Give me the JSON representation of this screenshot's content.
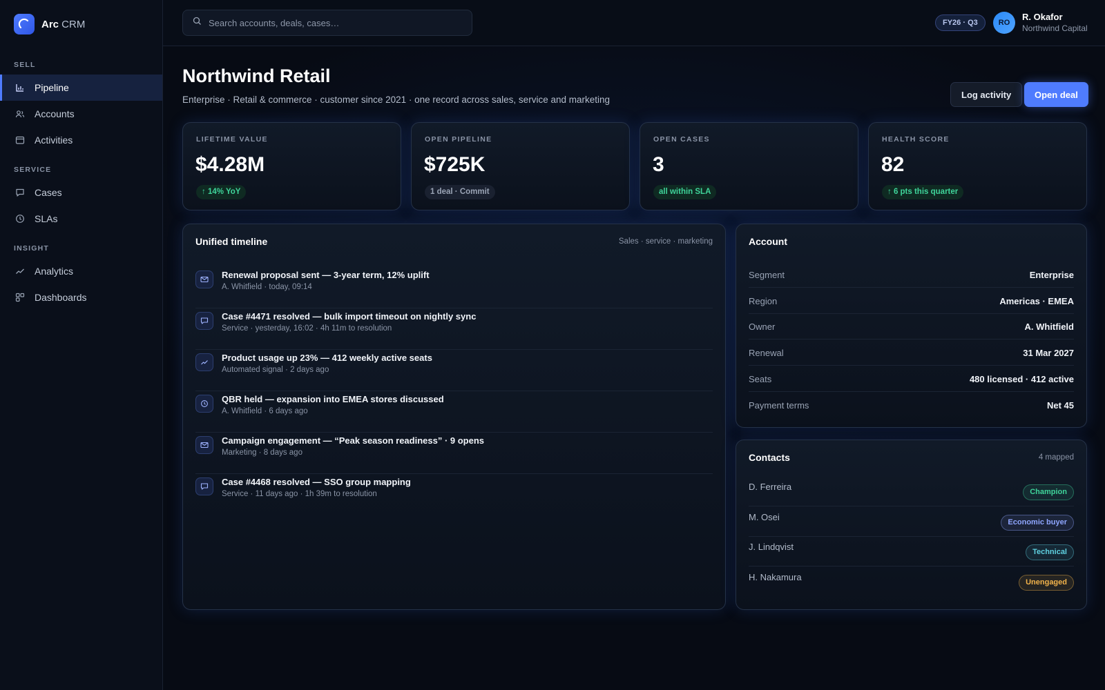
{
  "brand": {
    "name_bold": "Arc",
    "name_rest": " CRM"
  },
  "sidebar": {
    "sections": [
      {
        "label": "SELL",
        "items": [
          {
            "label": "Pipeline",
            "icon": "bar-chart-icon",
            "active": true
          },
          {
            "label": "Accounts",
            "icon": "users-icon"
          },
          {
            "label": "Activities",
            "icon": "calendar-icon"
          }
        ]
      },
      {
        "label": "SERVICE",
        "items": [
          {
            "label": "Cases",
            "icon": "message-icon"
          },
          {
            "label": "SLAs",
            "icon": "clock-icon"
          }
        ]
      },
      {
        "label": "INSIGHT",
        "items": [
          {
            "label": "Analytics",
            "icon": "trend-icon"
          },
          {
            "label": "Dashboards",
            "icon": "grid-icon"
          }
        ]
      }
    ]
  },
  "topbar": {
    "search_placeholder": "Search accounts, deals, cases…",
    "period_badge": "FY26 · Q3",
    "user": {
      "initials": "RO",
      "name": "R. Okafor",
      "org": "Northwind Capital"
    }
  },
  "page": {
    "title": "Northwind Retail",
    "subtitle": "Enterprise · Retail & commerce · customer since 2021 · one record across sales, service and marketing",
    "actions": {
      "secondary": "Log activity",
      "primary": "Open deal"
    }
  },
  "kpis": [
    {
      "label": "LIFETIME VALUE",
      "value": "$4.28M",
      "pill": "↑ 14% YoY",
      "tone": "green"
    },
    {
      "label": "OPEN PIPELINE",
      "value": "$725K",
      "pill": "1 deal · Commit",
      "tone": "gray"
    },
    {
      "label": "OPEN CASES",
      "value": "3",
      "pill": "all within SLA",
      "tone": "green"
    },
    {
      "label": "HEALTH SCORE",
      "value": "82",
      "pill": "↑ 6 pts this quarter",
      "tone": "green"
    }
  ],
  "timeline": {
    "title": "Unified timeline",
    "meta": "Sales · service · marketing",
    "items": [
      {
        "icon": "mail-icon",
        "title": "Renewal proposal sent — 3-year term, 12% uplift",
        "meta": "A. Whitfield · today, 09:14"
      },
      {
        "icon": "message-icon",
        "title": "Case #4471 resolved — bulk import timeout on nightly sync",
        "meta": "Service · yesterday, 16:02 · 4h 11m to resolution"
      },
      {
        "icon": "trend-icon",
        "title": "Product usage up 23% — 412 weekly active seats",
        "meta": "Automated signal · 2 days ago"
      },
      {
        "icon": "clock-icon",
        "title": "QBR held — expansion into EMEA stores discussed",
        "meta": "A. Whitfield · 6 days ago"
      },
      {
        "icon": "mail-icon",
        "title": "Campaign engagement — “Peak season readiness” · 9 opens",
        "meta": "Marketing · 8 days ago"
      },
      {
        "icon": "message-icon",
        "title": "Case #4468 resolved — SSO group mapping",
        "meta": "Service · 11 days ago · 1h 39m to resolution"
      }
    ]
  },
  "account": {
    "title": "Account",
    "rows": [
      {
        "key": "Segment",
        "value": "Enterprise"
      },
      {
        "key": "Region",
        "value": "Americas · EMEA"
      },
      {
        "key": "Owner",
        "value": "A. Whitfield"
      },
      {
        "key": "Renewal",
        "value": "31 Mar 2027"
      },
      {
        "key": "Seats",
        "value": "480 licensed · 412 active"
      },
      {
        "key": "Payment terms",
        "value": "Net 45"
      }
    ]
  },
  "contacts": {
    "title": "Contacts",
    "meta": "4 mapped",
    "rows": [
      {
        "name": "D. Ferreira",
        "tag": "Champion",
        "color": "#3fd49a"
      },
      {
        "name": "M. Osei",
        "tag": "Economic buyer",
        "color": "#8fa6ff"
      },
      {
        "name": "J. Lindqvist",
        "tag": "Technical",
        "color": "#5fd1e0"
      },
      {
        "name": "H. Nakamura",
        "tag": "Unengaged",
        "color": "#f2b34b"
      }
    ]
  },
  "colors": {
    "accent": "#4f7cff",
    "positive": "#3fd49a",
    "warning": "#f2b34b"
  }
}
